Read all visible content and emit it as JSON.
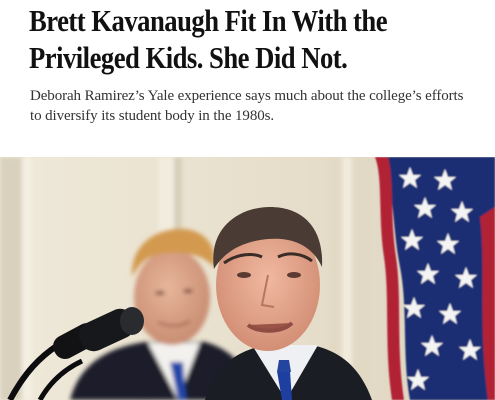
{
  "article": {
    "headline_line1": "Brett Kavanaugh Fit In With the",
    "headline_line2": "Privileged Kids. She Did Not.",
    "summary": "Deborah Ramirez’s Yale experience says much about the college’s efforts to diversify its student body in the 1980s."
  },
  "photo": {
    "icons": [
      "microphone-icon",
      "american-flag"
    ],
    "colors": {
      "wall": "#ebe5d5",
      "flag_blue": "#1b2f73",
      "flag_red": "#b22234",
      "suit": "#1b1d24",
      "tie": "#1f3fa0"
    }
  }
}
